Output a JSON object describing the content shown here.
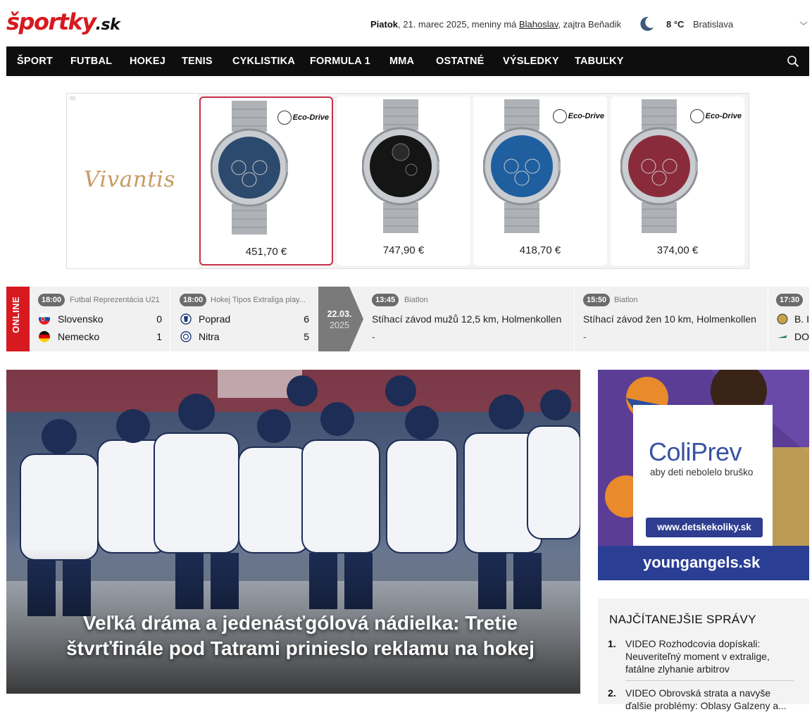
{
  "header": {
    "logo_main": "športky",
    "logo_suffix": ".sk",
    "day": "Piatok",
    "date_text": ", 21. marec 2025, meniny má ",
    "nameday": "Blahoslav",
    "tomorrow_text": ", zajtra Beňadik",
    "temperature": "8 °C",
    "city": "Bratislava",
    "weather_icon": "moon-icon"
  },
  "nav": {
    "items": [
      "ŠPORT",
      "FUTBAL",
      "HOKEJ",
      "TENIS",
      "CYKLISTIKA",
      "FORMULA 1",
      "MMA",
      "OSTATNÉ",
      "VÝSLEDKY",
      "TABUĽKY"
    ],
    "search_icon": "search-icon"
  },
  "ad_banner": {
    "brand": "Vivantis",
    "eco_label": "Eco-Drive",
    "products": [
      {
        "price": "451,70 €",
        "dial": "#2c4a6e"
      },
      {
        "price": "747,90 €",
        "dial": "#151515"
      },
      {
        "price": "418,70 €",
        "dial": "#1f5fa0"
      },
      {
        "price": "374,00 €",
        "dial": "#8a2b3c"
      }
    ]
  },
  "ticker": {
    "online_label": "ONLINE",
    "matches": [
      {
        "time": "18:00",
        "league": "Futbal Reprezentácia U21",
        "home": "Slovensko",
        "away": "Nemecko",
        "home_score": "0",
        "away_score": "1"
      },
      {
        "time": "18:00",
        "league": "Hokej Tipos Extraliga play...",
        "home": "Poprad",
        "away": "Nitra",
        "home_score": "6",
        "away_score": "5"
      }
    ],
    "date_divider": {
      "date": "22.03.",
      "year": "2025"
    },
    "events": [
      {
        "time": "13:45",
        "sport": "Biatlon",
        "title": "Stíhací závod mužů 12,5 km, Holmenkollen",
        "result": "-"
      },
      {
        "time": "15:50",
        "sport": "Biatlon",
        "title": "Stíhací závod žen 10 km, Holmenkollen",
        "result": "-"
      }
    ],
    "partial": {
      "time": "17:30",
      "home": "B. I",
      "away": "DO"
    }
  },
  "hero": {
    "title": "Veľká dráma a jedenásťgólová nádielka: Tretie štvrťfinále pod Tatrami prinieslo reklamu na hokej"
  },
  "side_ad": {
    "brand": "ColiPrev",
    "slogan": "aby deti nebolelo bruško",
    "url": "www.detskekoliky.sk",
    "footer": "youngangels.sk"
  },
  "most_read": {
    "title": "NAJČÍTANEJŠIE SPRÁVY",
    "items": [
      {
        "num": "1.",
        "text": "VIDEO Rozhodcovia dopískali: Neuveriteľný moment v extralige, fatálne zlyhanie arbitrov"
      },
      {
        "num": "2.",
        "text": "VIDEO Obrovská strata a navyše ďalšie problémy: Oblasy Galzeny a..."
      }
    ]
  }
}
